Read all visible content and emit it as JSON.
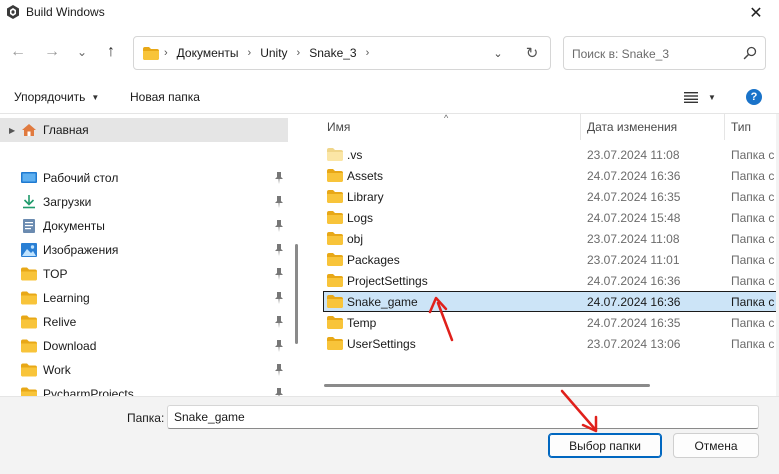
{
  "window": {
    "title": "Build Windows",
    "close_glyph": "✕"
  },
  "nav": {
    "back_glyph": "←",
    "forward_glyph": "→",
    "recent_glyph": "⌄",
    "up_glyph": "↑"
  },
  "address": {
    "crumbs": [
      "Документы",
      "Unity",
      "Snake_3"
    ],
    "sep_glyph": "›",
    "dropdown_glyph": "⌄",
    "refresh_glyph": "↻"
  },
  "search": {
    "placeholder": "Поиск в: Snake_3",
    "value": ""
  },
  "toolbar": {
    "organize_label": "Упорядочить",
    "new_folder_label": "Новая папка",
    "help_label": "?"
  },
  "sidebar": {
    "items": [
      {
        "label": "Главная",
        "icon": "home-icon",
        "pinned": false,
        "selected": true
      },
      {
        "label": "Рабочий стол",
        "icon": "desktop-icon",
        "pinned": true
      },
      {
        "label": "Загрузки",
        "icon": "download-icon",
        "pinned": true
      },
      {
        "label": "Документы",
        "icon": "documents-icon",
        "pinned": true
      },
      {
        "label": "Изображения",
        "icon": "pictures-icon",
        "pinned": true
      },
      {
        "label": "TOP",
        "icon": "folder-icon",
        "pinned": true
      },
      {
        "label": "Learning",
        "icon": "folder-icon",
        "pinned": true
      },
      {
        "label": "Relive",
        "icon": "folder-icon",
        "pinned": true
      },
      {
        "label": "Download",
        "icon": "folder-icon",
        "pinned": true
      },
      {
        "label": "Work",
        "icon": "folder-icon",
        "pinned": true
      },
      {
        "label": "PycharmProjects",
        "icon": "folder-icon",
        "pinned": true
      }
    ]
  },
  "file_list": {
    "columns": {
      "name": "Имя",
      "date": "Дата изменения",
      "type": "Тип"
    },
    "sort_glyph": "^",
    "rows": [
      {
        "name": ".vs",
        "date": "23.07.2024 11:08",
        "type": "Папка с",
        "selected": false
      },
      {
        "name": "Assets",
        "date": "24.07.2024 16:36",
        "type": "Папка с",
        "selected": false
      },
      {
        "name": "Library",
        "date": "24.07.2024 16:35",
        "type": "Папка с",
        "selected": false
      },
      {
        "name": "Logs",
        "date": "24.07.2024 15:48",
        "type": "Папка с",
        "selected": false
      },
      {
        "name": "obj",
        "date": "23.07.2024 11:08",
        "type": "Папка с",
        "selected": false
      },
      {
        "name": "Packages",
        "date": "23.07.2024 11:01",
        "type": "Папка с",
        "selected": false
      },
      {
        "name": "ProjectSettings",
        "date": "24.07.2024 16:36",
        "type": "Папка с",
        "selected": false
      },
      {
        "name": "Snake_game",
        "date": "24.07.2024 16:36",
        "type": "Папка с",
        "selected": true
      },
      {
        "name": "Temp",
        "date": "24.07.2024 16:35",
        "type": "Папка с",
        "selected": false
      },
      {
        "name": "UserSettings",
        "date": "23.07.2024 13:06",
        "type": "Папка с",
        "selected": false
      }
    ]
  },
  "footer": {
    "folder_label": "Папка:",
    "folder_value": "Snake_game",
    "select_button": "Выбор папки",
    "cancel_button": "Отмена"
  },
  "colors": {
    "folder": "#f8c43a",
    "folder_dark": "#e8a817",
    "selection": "#cce4f7",
    "accent": "#0067c0",
    "annotation": "#e0201b"
  }
}
